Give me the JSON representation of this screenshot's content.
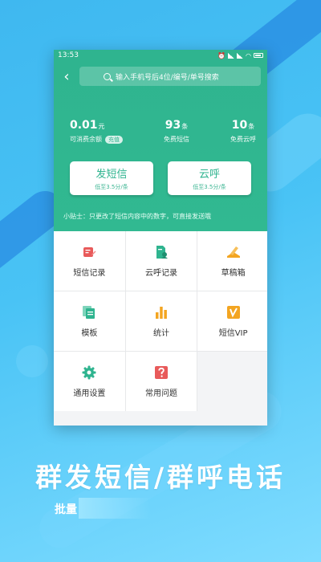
{
  "statusbar": {
    "time": "13:53"
  },
  "search": {
    "placeholder": "输入手机号后4位/编号/单号搜索"
  },
  "stats": [
    {
      "value": "0.01",
      "unit": "元",
      "label": "可消费余额",
      "badge": "充值"
    },
    {
      "value": "93",
      "unit": "条",
      "label": "免费短信"
    },
    {
      "value": "10",
      "unit": "条",
      "label": "免费云呼"
    }
  ],
  "buttons": [
    {
      "title": "发短信",
      "sub": "低至3.5分/条"
    },
    {
      "title": "云呼",
      "sub": "低至3.5分/条"
    }
  ],
  "tip": "小贴士：只更改了短信内容中的数字，可直接发送哦",
  "grid": [
    {
      "label": "短信记录",
      "icon": "sms-record-icon",
      "color": "#e85a5a"
    },
    {
      "label": "云呼记录",
      "icon": "call-record-icon",
      "color": "#2fb48f"
    },
    {
      "label": "草稿箱",
      "icon": "draft-box-icon",
      "color": "#f3a521"
    },
    {
      "label": "模板",
      "icon": "template-icon",
      "color": "#2fb48f"
    },
    {
      "label": "统计",
      "icon": "statistics-icon",
      "color": "#f3a521"
    },
    {
      "label": "短信VIP",
      "icon": "vip-icon",
      "color": "#f3a521"
    },
    {
      "label": "通用设置",
      "icon": "gear-icon",
      "color": "#2fb48f"
    },
    {
      "label": "常用问题",
      "icon": "question-icon",
      "color": "#e85a5a"
    }
  ],
  "banner": {
    "title": "群发短信/群呼电话",
    "subtitle": "批量"
  },
  "colors": {
    "primary": "#2fb48f",
    "background": "#49c3f5"
  }
}
